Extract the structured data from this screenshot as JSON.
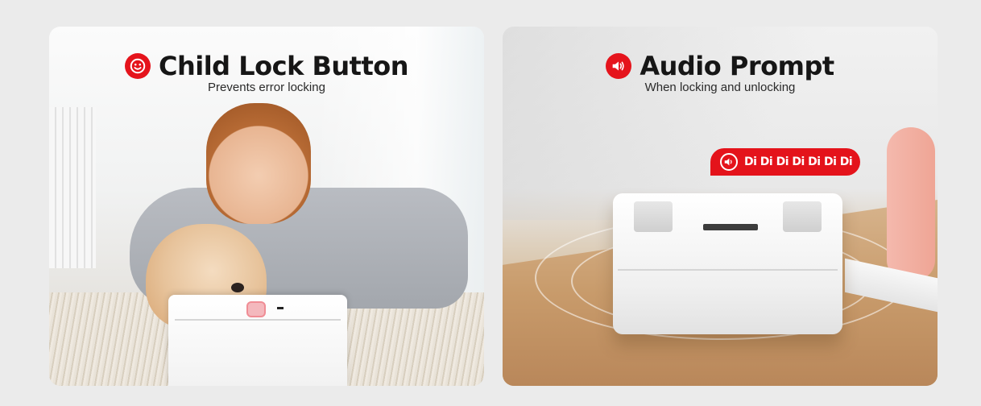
{
  "colors": {
    "accent": "#e5141c",
    "background": "#ebebeb"
  },
  "left_panel": {
    "title": "Child Lock Button",
    "subtitle": "Prevents error locking",
    "icon": "smiley-face-icon"
  },
  "right_panel": {
    "title": "Audio Prompt",
    "subtitle": "When locking and unlocking",
    "icon": "speaker-icon",
    "badge_text": "Di Di Di Di Di Di Di",
    "badge_icon": "speaker-icon"
  }
}
